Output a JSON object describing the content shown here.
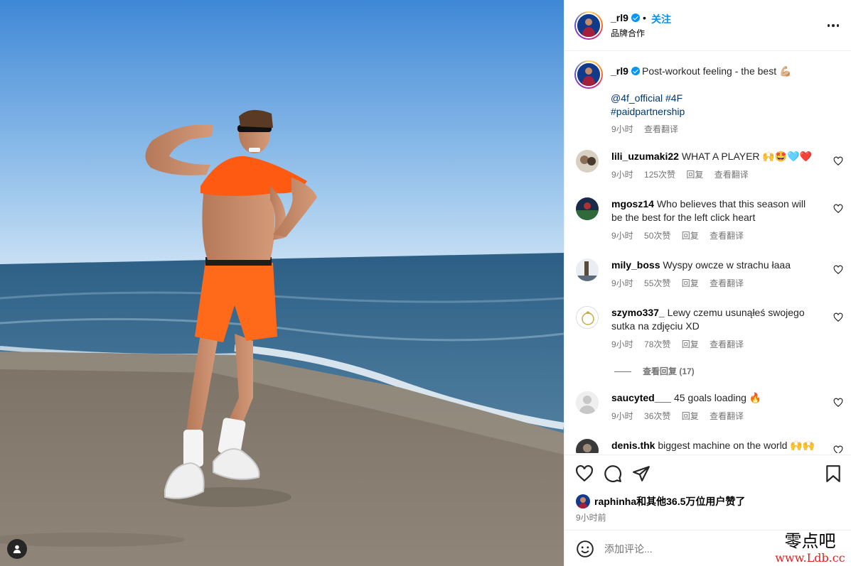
{
  "post": {
    "header": {
      "username": "_rl9",
      "separator": "•",
      "follow_label": "关注",
      "subtitle": "品牌合作"
    },
    "caption": {
      "username": "_rl9",
      "text": "Post-workout feeling - the best 💪🏼",
      "tags_line1": "@4f_official #4F",
      "tags_line2": "#paidpartnership",
      "time": "9小时",
      "translate": "查看翻译"
    },
    "comments": [
      {
        "username": "lili_uzumaki22",
        "text": "WHAT A PLAYER 🙌🤩🩵❤️",
        "time": "9小时",
        "likes": "125次赞",
        "reply": "回复",
        "translate": "查看翻译"
      },
      {
        "username": "mgosz14",
        "text": "Who believes that this season will be the best for the left click heart",
        "time": "9小时",
        "likes": "50次赞",
        "reply": "回复",
        "translate": "查看翻译"
      },
      {
        "username": "mily_boss",
        "text": "Wyspy owcze w strachu łaaa",
        "time": "9小时",
        "likes": "55次赞",
        "reply": "回复",
        "translate": "查看翻译"
      },
      {
        "username": "szymo337_",
        "text": "Lewy czemu usunąłeś swojego sutka na zdjęciu XD",
        "time": "9小时",
        "likes": "78次赞",
        "reply": "回复",
        "translate": "查看翻译"
      },
      {
        "username": "saucyted___",
        "text": "45 goals loading 🔥",
        "time": "9小时",
        "likes": "36次赞",
        "reply": "回复",
        "translate": "查看翻译"
      },
      {
        "username": "denis.thk",
        "text": "biggest machine on the world 🙌🙌"
      }
    ],
    "view_replies": "查看回复 (17)",
    "likes_text": "raphinha和其他36.5万位用户赞了",
    "time_ago": "9小时前",
    "comment_placeholder": "添加评论..."
  },
  "watermark": {
    "top": "零点吧",
    "url": "www.Ldb.cc"
  },
  "colors": {
    "link": "#00376b",
    "follow": "#0095f6",
    "meta": "#737373",
    "sky": "#4e93d8",
    "shorts": "#ff6a1a"
  },
  "icons": [
    "more-icon",
    "verified-icon",
    "heart-icon",
    "comment-icon",
    "share-icon",
    "bookmark-icon",
    "emoji-icon",
    "user-tag-icon"
  ]
}
